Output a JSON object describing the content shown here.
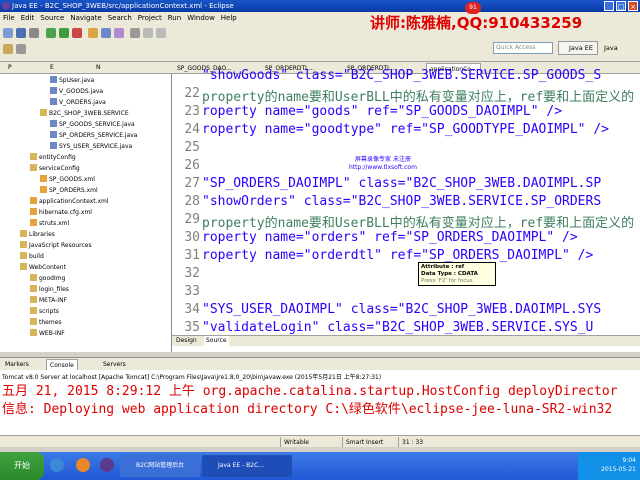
{
  "window": {
    "title": "Java EE - B2C_SHOP_3WEB/src/applicationContext.xml - Eclipse"
  },
  "watermark": "讲师:陈雅楠,QQ:910433259",
  "badge": "91",
  "menu": [
    "File",
    "Edit",
    "Source",
    "Navigate",
    "Search",
    "Project",
    "Run",
    "Window",
    "Help"
  ],
  "toolbar": {
    "quick_access": "Quick Access",
    "perspective": "Java EE",
    "perspective2": "Java"
  },
  "left_tabs": [
    "P",
    "E",
    "N"
  ],
  "tree": [
    {
      "label": "SpUser.java",
      "indent": 5
    },
    {
      "label": "V_GOODS.java",
      "indent": 5
    },
    {
      "label": "V_ORDERS.java",
      "indent": 5
    },
    {
      "label": "B2C_SHOP_3WEB.SERVICE",
      "indent": 4
    },
    {
      "label": "SP_GOODS_SERVICE.java",
      "indent": 5
    },
    {
      "label": "SP_ORDERS_SERVICE.java",
      "indent": 5
    },
    {
      "label": "SYS_USER_SERVICE.java",
      "indent": 5
    },
    {
      "label": "entityConfig",
      "indent": 3
    },
    {
      "label": "serviceConfig",
      "indent": 3
    },
    {
      "label": "SP_GOODS.xml",
      "indent": 4
    },
    {
      "label": "SP_ORDERS.xml",
      "indent": 4
    },
    {
      "label": "applicationContext.xml",
      "indent": 3
    },
    {
      "label": "hibernate.cfg.xml",
      "indent": 3
    },
    {
      "label": "struts.xml",
      "indent": 3
    },
    {
      "label": "Libraries",
      "indent": 2
    },
    {
      "label": "JavaScript Resources",
      "indent": 2
    },
    {
      "label": "build",
      "indent": 2
    },
    {
      "label": "WebContent",
      "indent": 2
    },
    {
      "label": "goodImg",
      "indent": 3
    },
    {
      "label": "login_files",
      "indent": 3
    },
    {
      "label": "META-INF",
      "indent": 3
    },
    {
      "label": "scripts",
      "indent": 3
    },
    {
      "label": "themes",
      "indent": 3
    },
    {
      "label": "WEB-INF",
      "indent": 3
    }
  ],
  "editor_tabs": [
    "SP_GOODS_DAO...",
    "SP_ORDERDTL...",
    "SP_ORDERDTL...",
    "applicationCo..."
  ],
  "code_lines": [
    {
      "num": "",
      "text": "\"showGoods\" class=\"B2C_SHOP_3WEB.SERVICE.SP_GOODS_S"
    },
    {
      "num": "22",
      "text": "property的name要和UserBLL中的私有变量对应上，ref要和上面定义的"
    },
    {
      "num": "23",
      "text": "roperty name=\"goods\" ref=\"SP_GOODS_DAOIMPL\" />"
    },
    {
      "num": "24",
      "text": "roperty name=\"goodtype\" ref=\"SP_GOODTYPE_DAOIMPL\" />"
    },
    {
      "num": "25",
      "text": ""
    },
    {
      "num": "26",
      "text": ""
    },
    {
      "num": "27",
      "text": "\"SP_ORDERS_DAOIMPL\" class=\"B2C_SHOP_3WEB.DAOIMPL.SP"
    },
    {
      "num": "28",
      "text": "\"showOrders\" class=\"B2C_SHOP_3WEB.SERVICE.SP_ORDERS"
    },
    {
      "num": "29",
      "text": "property的name要和UserBLL中的私有变量对应上，ref要和上面定义的"
    },
    {
      "num": "30",
      "text": "roperty name=\"orders\" ref=\"SP_ORDERS_DAOIMPL\" />"
    },
    {
      "num": "31",
      "text": "roperty name=\"orderdtl\" ref=\"SP_ORDERS_DAOIMPL\" />"
    },
    {
      "num": "32",
      "text": ""
    },
    {
      "num": "33",
      "text": ""
    },
    {
      "num": "34",
      "text": "\"SYS_USER_DAOIMPL\" class=\"B2C_SHOP_3WEB.DAOIMPL.SYS"
    },
    {
      "num": "35",
      "text": "\"validateLogin\" class=\"B2C_SHOP_3WEB.SERVICE.SYS_U"
    }
  ],
  "ad": {
    "line1": "屏幕录像专家   未注册",
    "line2": "http://www.tlxsoft.com"
  },
  "tooltip": {
    "line1": "Attribute : ref",
    "line2": "Data Type : CDATA",
    "line3": "Press 'F2' for focus"
  },
  "design_tabs": [
    "Design",
    "Source"
  ],
  "console_tabs": [
    "Markers",
    "Console",
    "Servers"
  ],
  "console_header": "Tomcat v8.0 Server at localhost [Apache Tomcat] C:\\Program Files\\Java\\jre1.8.0_20\\bin\\javaw.exe (2015年5月21日 上午8:27:31)",
  "console_lines": [
    "五月 21, 2015 8:29:12 上午 org.apache.catalina.startup.HostConfig deployDirector",
    "信息: Deploying web application directory C:\\绿色软件\\eclipse-jee-luna-SR2-win32"
  ],
  "status": {
    "writable": "Writable",
    "mode": "Smart Insert",
    "position": "31 : 33"
  },
  "taskbar": {
    "start": "开始",
    "task1": "B2C网站管理后台",
    "task2": "Java EE - B2C...",
    "time": "9:04",
    "date": "2015-05-21"
  }
}
